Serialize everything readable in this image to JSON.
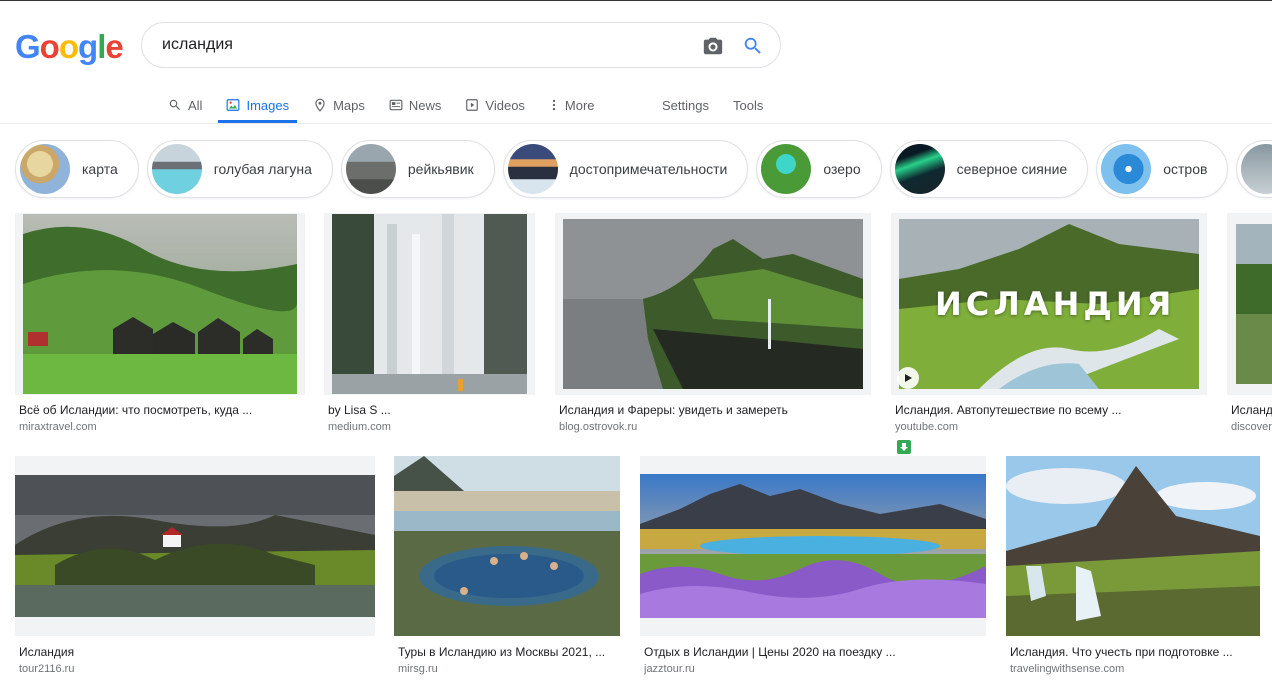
{
  "logo": {
    "letters": [
      "G",
      "o",
      "o",
      "g",
      "l",
      "e"
    ],
    "colors": [
      "#4285f4",
      "#ea4335",
      "#fbbc05",
      "#4285f4",
      "#34a853",
      "#ea4335"
    ]
  },
  "search": {
    "value": "исландия",
    "camera_icon": "camera-icon",
    "search_icon": "search-icon"
  },
  "tabs": [
    {
      "label": "All",
      "icon": "search-icon"
    },
    {
      "label": "Images",
      "icon": "image-icon",
      "active": true
    },
    {
      "label": "Maps",
      "icon": "map-pin-icon"
    },
    {
      "label": "News",
      "icon": "news-icon"
    },
    {
      "label": "Videos",
      "icon": "video-icon"
    },
    {
      "label": "More",
      "icon": "more-vert-icon"
    }
  ],
  "tools": {
    "settings": "Settings",
    "tools": "Tools"
  },
  "chips": [
    {
      "label": "карта"
    },
    {
      "label": "голубая лагуна"
    },
    {
      "label": "рейкьявик"
    },
    {
      "label": "достопримечательности"
    },
    {
      "label": "озеро"
    },
    {
      "label": "северное сияние"
    },
    {
      "label": "остров"
    }
  ],
  "results_row1": [
    {
      "title": "Всё об Исландии: что посмотреть, куда ...",
      "source": "miraxtravel.com"
    },
    {
      "title": "by Lisa S ...",
      "source": "medium.com"
    },
    {
      "title": "Исландия и Фареры: увидеть и замереть",
      "source": "blog.ostrovok.ru"
    },
    {
      "title": "Исландия. Автопутешествие по всему ...",
      "source": "youtube.com",
      "overlay": "ИСЛАНДИЯ"
    },
    {
      "title": "Исланд",
      "source": "discover"
    }
  ],
  "results_row2": [
    {
      "title": "Исландия",
      "source": "tour2116.ru"
    },
    {
      "title": "Туры в Исландию из Москвы 2021, ...",
      "source": "mirsg.ru"
    },
    {
      "title": "Отдых в Исландии | Цены 2020 на поездку ...",
      "source": "jazztour.ru"
    },
    {
      "title": "Исландия. Что учесть при подготовке ...",
      "source": "travelingwithsense.com"
    }
  ],
  "colors": {
    "accent": "#1a73e8",
    "text_secondary": "#5f6368",
    "source_text": "#70757a"
  }
}
